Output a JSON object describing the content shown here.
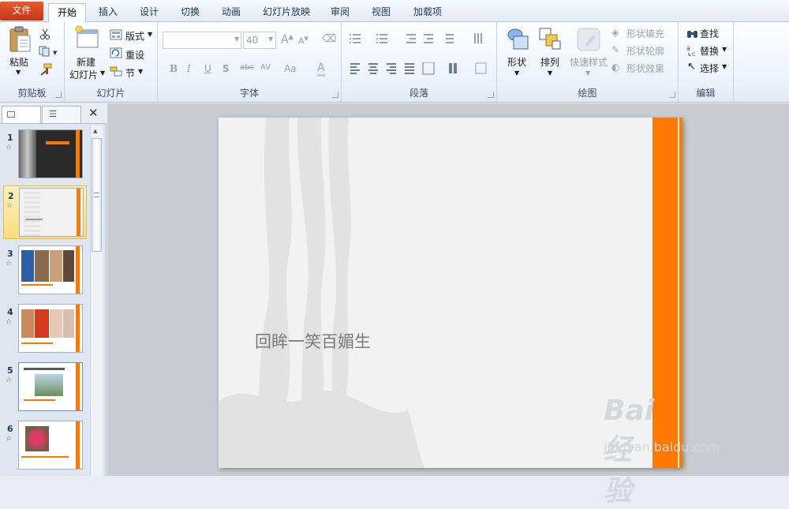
{
  "tabs": {
    "file": "文件",
    "home": "开始",
    "insert": "插入",
    "design": "设计",
    "transitions": "切换",
    "animations": "动画",
    "slideshow": "幻灯片放映",
    "review": "审阅",
    "view": "视图",
    "addins": "加载项"
  },
  "clipboard": {
    "paste": "粘贴",
    "label": "剪贴板"
  },
  "slides": {
    "new_line1": "新建",
    "new_line2": "幻灯片",
    "layout": "版式",
    "reset": "重设",
    "section": "节",
    "label": "幻灯片"
  },
  "font": {
    "size": "40",
    "label": "字体",
    "bold": "B",
    "italic": "I",
    "underline": "U",
    "shadow": "S",
    "strike": "abc",
    "spacing": "AV",
    "case": "Aa",
    "color": "A"
  },
  "paragraph": {
    "label": "段落"
  },
  "drawing": {
    "shapes": "形状",
    "arrange": "排列",
    "quick_styles": "快速样式",
    "fill": "形状填充",
    "outline": "形状轮廓",
    "effects": "形状效果",
    "label": "绘图"
  },
  "editing": {
    "find": "查找",
    "replace": "替换",
    "select": "选择",
    "label": "编辑"
  },
  "thumbnails": [
    {
      "num": "1"
    },
    {
      "num": "2"
    },
    {
      "num": "3"
    },
    {
      "num": "4"
    },
    {
      "num": "5"
    },
    {
      "num": "6"
    }
  ],
  "slide": {
    "title": "回眸一笑百媚生"
  },
  "watermark": {
    "brand": "Bai 经验",
    "url": "jingyan.baidu.com"
  },
  "colors": {
    "accent_orange": "#fd7900",
    "file_tab": "#d4491f"
  }
}
